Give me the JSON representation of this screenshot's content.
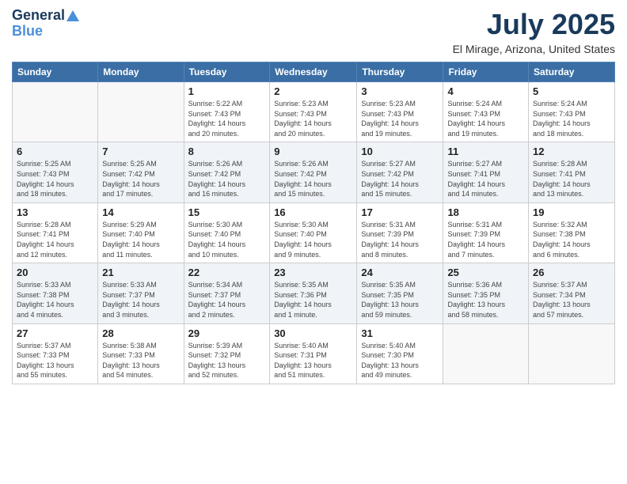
{
  "logo": {
    "line1": "General",
    "line2": "Blue"
  },
  "title": "July 2025",
  "subtitle": "El Mirage, Arizona, United States",
  "weekdays": [
    "Sunday",
    "Monday",
    "Tuesday",
    "Wednesday",
    "Thursday",
    "Friday",
    "Saturday"
  ],
  "weeks": [
    [
      {
        "day": "",
        "info": ""
      },
      {
        "day": "",
        "info": ""
      },
      {
        "day": "1",
        "info": "Sunrise: 5:22 AM\nSunset: 7:43 PM\nDaylight: 14 hours\nand 20 minutes."
      },
      {
        "day": "2",
        "info": "Sunrise: 5:23 AM\nSunset: 7:43 PM\nDaylight: 14 hours\nand 20 minutes."
      },
      {
        "day": "3",
        "info": "Sunrise: 5:23 AM\nSunset: 7:43 PM\nDaylight: 14 hours\nand 19 minutes."
      },
      {
        "day": "4",
        "info": "Sunrise: 5:24 AM\nSunset: 7:43 PM\nDaylight: 14 hours\nand 19 minutes."
      },
      {
        "day": "5",
        "info": "Sunrise: 5:24 AM\nSunset: 7:43 PM\nDaylight: 14 hours\nand 18 minutes."
      }
    ],
    [
      {
        "day": "6",
        "info": "Sunrise: 5:25 AM\nSunset: 7:43 PM\nDaylight: 14 hours\nand 18 minutes."
      },
      {
        "day": "7",
        "info": "Sunrise: 5:25 AM\nSunset: 7:42 PM\nDaylight: 14 hours\nand 17 minutes."
      },
      {
        "day": "8",
        "info": "Sunrise: 5:26 AM\nSunset: 7:42 PM\nDaylight: 14 hours\nand 16 minutes."
      },
      {
        "day": "9",
        "info": "Sunrise: 5:26 AM\nSunset: 7:42 PM\nDaylight: 14 hours\nand 15 minutes."
      },
      {
        "day": "10",
        "info": "Sunrise: 5:27 AM\nSunset: 7:42 PM\nDaylight: 14 hours\nand 15 minutes."
      },
      {
        "day": "11",
        "info": "Sunrise: 5:27 AM\nSunset: 7:41 PM\nDaylight: 14 hours\nand 14 minutes."
      },
      {
        "day": "12",
        "info": "Sunrise: 5:28 AM\nSunset: 7:41 PM\nDaylight: 14 hours\nand 13 minutes."
      }
    ],
    [
      {
        "day": "13",
        "info": "Sunrise: 5:28 AM\nSunset: 7:41 PM\nDaylight: 14 hours\nand 12 minutes."
      },
      {
        "day": "14",
        "info": "Sunrise: 5:29 AM\nSunset: 7:40 PM\nDaylight: 14 hours\nand 11 minutes."
      },
      {
        "day": "15",
        "info": "Sunrise: 5:30 AM\nSunset: 7:40 PM\nDaylight: 14 hours\nand 10 minutes."
      },
      {
        "day": "16",
        "info": "Sunrise: 5:30 AM\nSunset: 7:40 PM\nDaylight: 14 hours\nand 9 minutes."
      },
      {
        "day": "17",
        "info": "Sunrise: 5:31 AM\nSunset: 7:39 PM\nDaylight: 14 hours\nand 8 minutes."
      },
      {
        "day": "18",
        "info": "Sunrise: 5:31 AM\nSunset: 7:39 PM\nDaylight: 14 hours\nand 7 minutes."
      },
      {
        "day": "19",
        "info": "Sunrise: 5:32 AM\nSunset: 7:38 PM\nDaylight: 14 hours\nand 6 minutes."
      }
    ],
    [
      {
        "day": "20",
        "info": "Sunrise: 5:33 AM\nSunset: 7:38 PM\nDaylight: 14 hours\nand 4 minutes."
      },
      {
        "day": "21",
        "info": "Sunrise: 5:33 AM\nSunset: 7:37 PM\nDaylight: 14 hours\nand 3 minutes."
      },
      {
        "day": "22",
        "info": "Sunrise: 5:34 AM\nSunset: 7:37 PM\nDaylight: 14 hours\nand 2 minutes."
      },
      {
        "day": "23",
        "info": "Sunrise: 5:35 AM\nSunset: 7:36 PM\nDaylight: 14 hours\nand 1 minute."
      },
      {
        "day": "24",
        "info": "Sunrise: 5:35 AM\nSunset: 7:35 PM\nDaylight: 13 hours\nand 59 minutes."
      },
      {
        "day": "25",
        "info": "Sunrise: 5:36 AM\nSunset: 7:35 PM\nDaylight: 13 hours\nand 58 minutes."
      },
      {
        "day": "26",
        "info": "Sunrise: 5:37 AM\nSunset: 7:34 PM\nDaylight: 13 hours\nand 57 minutes."
      }
    ],
    [
      {
        "day": "27",
        "info": "Sunrise: 5:37 AM\nSunset: 7:33 PM\nDaylight: 13 hours\nand 55 minutes."
      },
      {
        "day": "28",
        "info": "Sunrise: 5:38 AM\nSunset: 7:33 PM\nDaylight: 13 hours\nand 54 minutes."
      },
      {
        "day": "29",
        "info": "Sunrise: 5:39 AM\nSunset: 7:32 PM\nDaylight: 13 hours\nand 52 minutes."
      },
      {
        "day": "30",
        "info": "Sunrise: 5:40 AM\nSunset: 7:31 PM\nDaylight: 13 hours\nand 51 minutes."
      },
      {
        "day": "31",
        "info": "Sunrise: 5:40 AM\nSunset: 7:30 PM\nDaylight: 13 hours\nand 49 minutes."
      },
      {
        "day": "",
        "info": ""
      },
      {
        "day": "",
        "info": ""
      }
    ]
  ]
}
